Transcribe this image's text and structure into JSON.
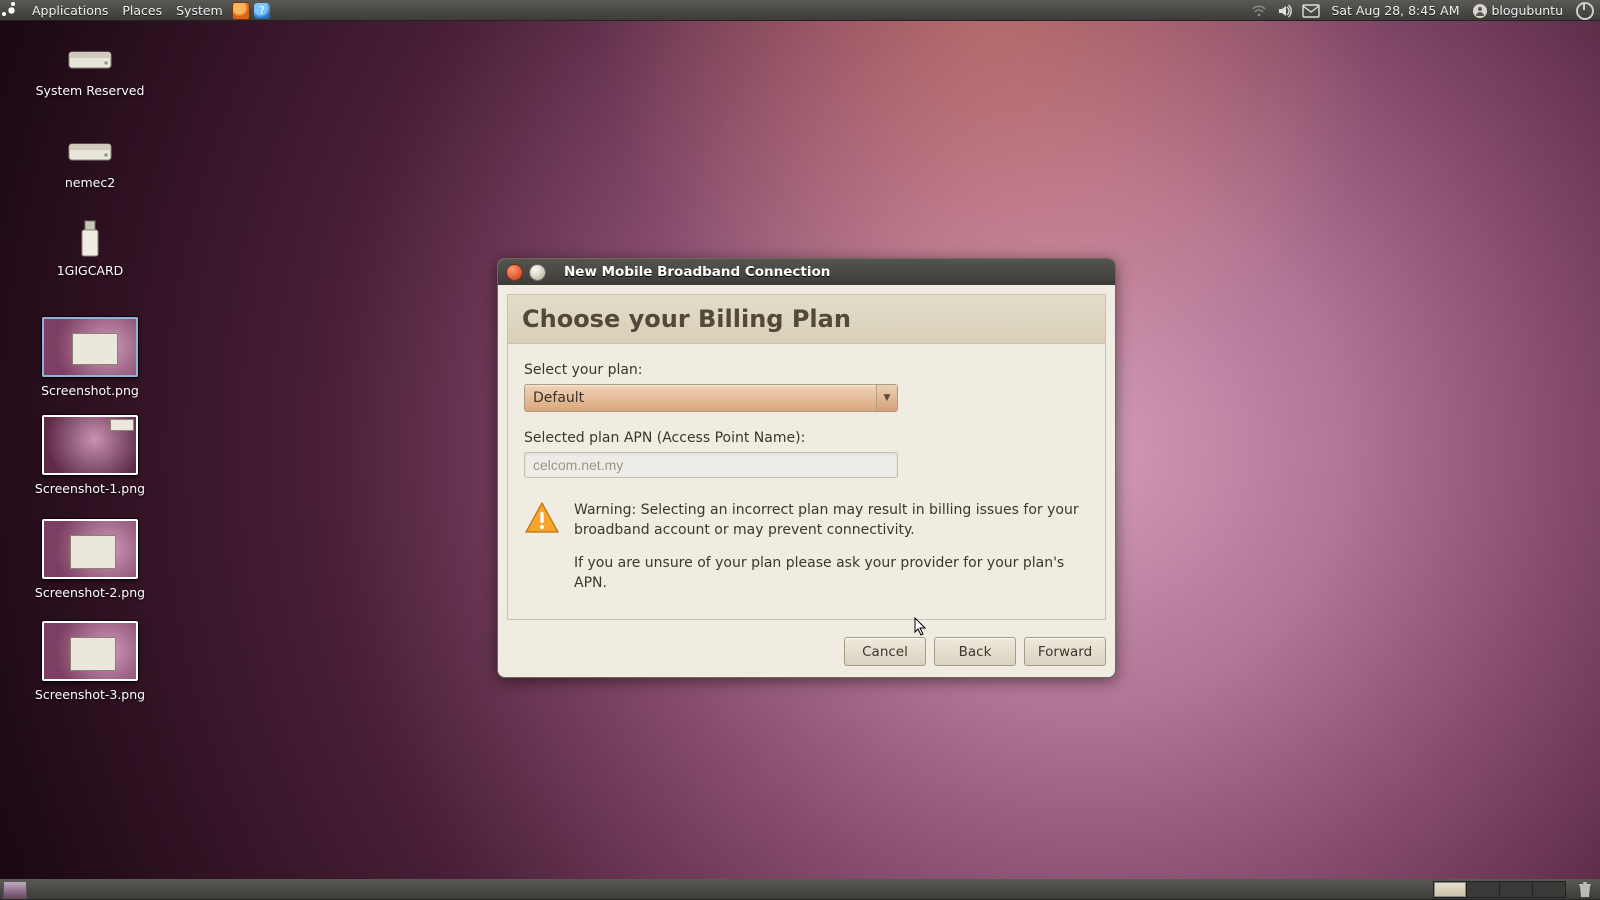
{
  "panel": {
    "menus": [
      "Applications",
      "Places",
      "System"
    ],
    "datetime": "Sat Aug 28,  8:45 AM",
    "username": "blogubuntu"
  },
  "desktop_icons": [
    {
      "name": "System Reserved",
      "kind": "drive"
    },
    {
      "name": "nemec2",
      "kind": "drive"
    },
    {
      "name": "1GIGCARD",
      "kind": "usb"
    },
    {
      "name": "Screenshot.png",
      "kind": "thumb",
      "variant": "a",
      "win": [
        28,
        14,
        44,
        30
      ],
      "selected": true
    },
    {
      "name": "Screenshot-1.png",
      "kind": "thumb",
      "variant": "b",
      "win": [
        66,
        2,
        22,
        10
      ]
    },
    {
      "name": "Screenshot-2.png",
      "kind": "thumb",
      "variant": "a",
      "win": [
        26,
        14,
        44,
        32
      ]
    },
    {
      "name": "Screenshot-3.png",
      "kind": "thumb",
      "variant": "a",
      "win": [
        26,
        14,
        44,
        32
      ]
    }
  ],
  "dialog": {
    "title": "New Mobile Broadband Connection",
    "heading": "Choose your Billing Plan",
    "select_label": "Select your plan:",
    "plan_value": "Default",
    "apn_label": "Selected plan APN (Access Point Name):",
    "apn_value": "celcom.net.my",
    "warning1": "Warning: Selecting an incorrect plan may result in billing issues for your broadband account or may prevent connectivity.",
    "warning2": "If you are unsure of your plan please ask your provider for your plan's APN.",
    "buttons": {
      "cancel": "Cancel",
      "back": "Back",
      "forward": "Forward"
    }
  }
}
